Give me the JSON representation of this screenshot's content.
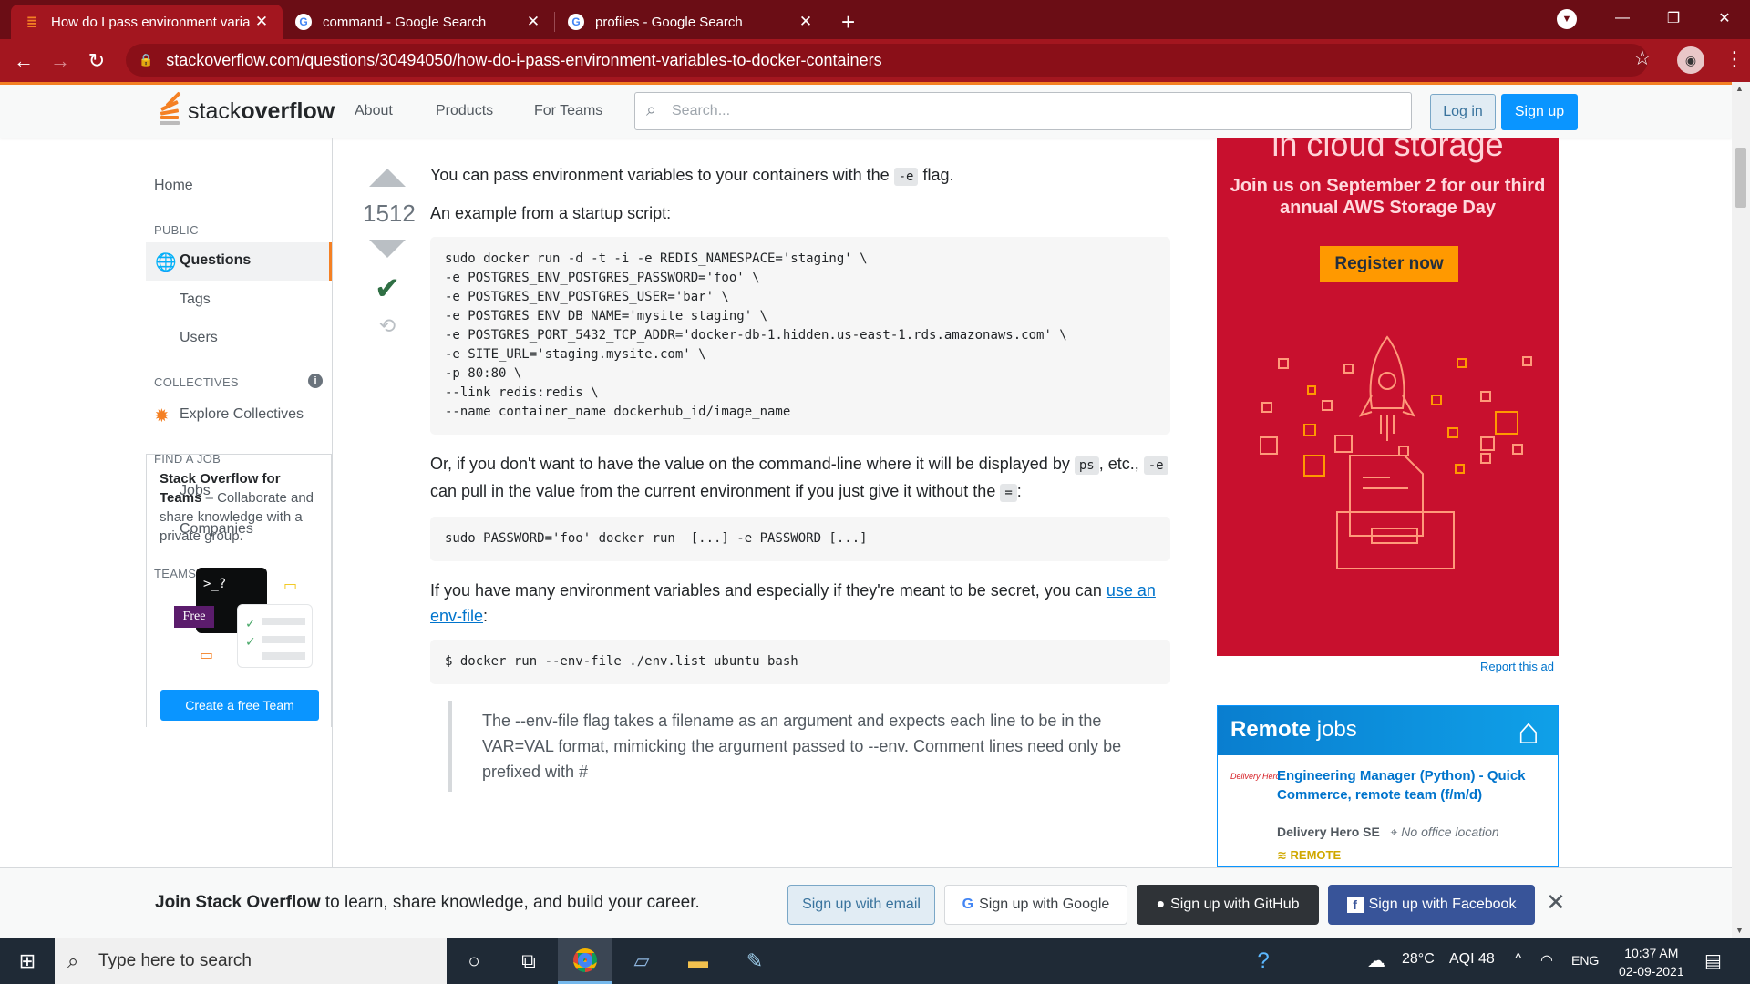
{
  "browser": {
    "tabs": [
      {
        "title": "How do I pass environment varia",
        "favicon": "stackoverflow-icon"
      },
      {
        "title": "command - Google Search",
        "favicon": "google-icon"
      },
      {
        "title": "profiles - Google Search",
        "favicon": "google-icon"
      }
    ],
    "url": "stackoverflow.com/questions/30494050/how-do-i-pass-environment-variables-to-docker-containers"
  },
  "header": {
    "logo_a": "stack",
    "logo_b": "overflow",
    "nav": [
      "About",
      "Products",
      "For Teams"
    ],
    "search_placeholder": "Search...",
    "login": "Log in",
    "signup": "Sign up"
  },
  "sidebar": {
    "home": "Home",
    "public": "PUBLIC",
    "questions": "Questions",
    "tags": "Tags",
    "users": "Users",
    "collectives": "COLLECTIVES",
    "explore": "Explore Collectives",
    "find_job": "FIND A JOB",
    "jobs": "Jobs",
    "companies": "Companies",
    "teams": "TEAMS",
    "teams_title": "Stack Overflow for Teams",
    "teams_desc": " – Collaborate and share knowledge with a private group.",
    "free": "Free",
    "terminal": ">_?",
    "create_team": "Create a free Team"
  },
  "answer": {
    "score": "1512",
    "p1_a": "You can pass environment variables to your containers with the ",
    "p1_code": "-e",
    "p1_b": " flag.",
    "p2": "An example from a startup script:",
    "code1": "sudo docker run -d -t -i -e REDIS_NAMESPACE='staging' \\\n-e POSTGRES_ENV_POSTGRES_PASSWORD='foo' \\\n-e POSTGRES_ENV_POSTGRES_USER='bar' \\\n-e POSTGRES_ENV_DB_NAME='mysite_staging' \\\n-e POSTGRES_PORT_5432_TCP_ADDR='docker-db-1.hidden.us-east-1.rds.amazonaws.com' \\\n-e SITE_URL='staging.mysite.com' \\\n-p 80:80 \\\n--link redis:redis \\\n--name container_name dockerhub_id/image_name",
    "p3_a": "Or, if you don't want to have the value on the command-line where it will be displayed by ",
    "p3_code1": "ps",
    "p3_b": ", etc., ",
    "p3_code2": "-e",
    "p3_c": " can pull in the value from the current environment if you just give it without the ",
    "p3_code3": "=",
    "p3_d": ":",
    "code2": "sudo PASSWORD='foo' docker run  [...] -e PASSWORD [...]",
    "p4_a": "If you have many environment variables and especially if they're meant to be secret, you can ",
    "p4_link": "use an env-file",
    "p4_b": ":",
    "code3": "$ docker run --env-file ./env.list ubuntu bash",
    "quote": "The --env-file flag takes a filename as an argument and expects each line to be in the VAR=VAL format, mimicking the argument passed to --env. Comment lines need only be prefixed with #"
  },
  "ad": {
    "headline": "in cloud storage",
    "sub": "Join us on September 2 for our third annual AWS Storage Day",
    "cta": "Register now",
    "report": "Report this ad"
  },
  "jobs": {
    "title_a": "Remote",
    "title_b": " jobs",
    "job_title": "Engineering Manager (Python) - Quick Commerce, remote team (f/m/d)",
    "company": "Delivery Hero SE",
    "logo_text": "Delivery Hero",
    "location": "No office location",
    "remote": "REMOTE"
  },
  "banner": {
    "bold": "Join Stack Overflow",
    "rest": " to learn, share knowledge, and build your career.",
    "email": "Sign up with email",
    "google": "Sign up with Google",
    "github": "Sign up with GitHub",
    "facebook": "Sign up with Facebook"
  },
  "taskbar": {
    "search": "Type here to search",
    "temp": "28°C",
    "aqi": "AQI 48",
    "lang": "ENG",
    "time": "10:37 AM",
    "date": "02-09-2021"
  },
  "colors": {
    "so_orange": "#f48024",
    "so_blue": "#0a95ff",
    "chrome_red": "#a3161f",
    "ad_red": "#c8102e"
  }
}
